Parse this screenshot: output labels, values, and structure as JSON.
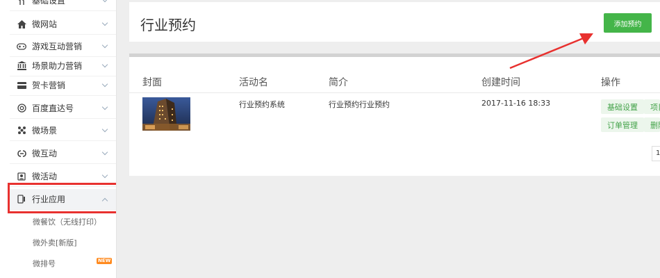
{
  "sidebar": {
    "items": [
      {
        "label": "基础设置",
        "icon": "utensils-icon"
      },
      {
        "label": "微网站",
        "icon": "home-icon"
      },
      {
        "label": "游戏互动营销",
        "icon": "gamepad-icon"
      },
      {
        "label": "场景助力营销",
        "icon": "bank-icon"
      },
      {
        "label": "贺卡营销",
        "icon": "card-icon"
      },
      {
        "label": "百度直达号",
        "icon": "baidu-icon"
      },
      {
        "label": "微场景",
        "icon": "grid-dots-icon"
      },
      {
        "label": "微互动",
        "icon": "link-icon"
      },
      {
        "label": "微活动",
        "icon": "activity-icon"
      },
      {
        "label": "行业应用",
        "icon": "mobile-icon"
      }
    ],
    "sub_items": [
      {
        "label": "微餐饮（无线打印）"
      },
      {
        "label": "微外卖[新版]"
      },
      {
        "label": "微排号",
        "badge": "NEW"
      }
    ]
  },
  "header": {
    "title": "行业预约",
    "add_button": "添加预约"
  },
  "table": {
    "columns": [
      "封面",
      "活动名",
      "简介",
      "创建时间",
      "操作"
    ],
    "rows": [
      {
        "name": "行业预约系统",
        "intro": "行业预约行业预约",
        "created": "2017-11-16 18:33",
        "actions": [
          "基础设置",
          "项目",
          "订单管理",
          "删除"
        ]
      }
    ]
  },
  "pagination": {
    "current": "1"
  },
  "colors": {
    "accent": "#44b549",
    "highlight": "#e8312f"
  }
}
